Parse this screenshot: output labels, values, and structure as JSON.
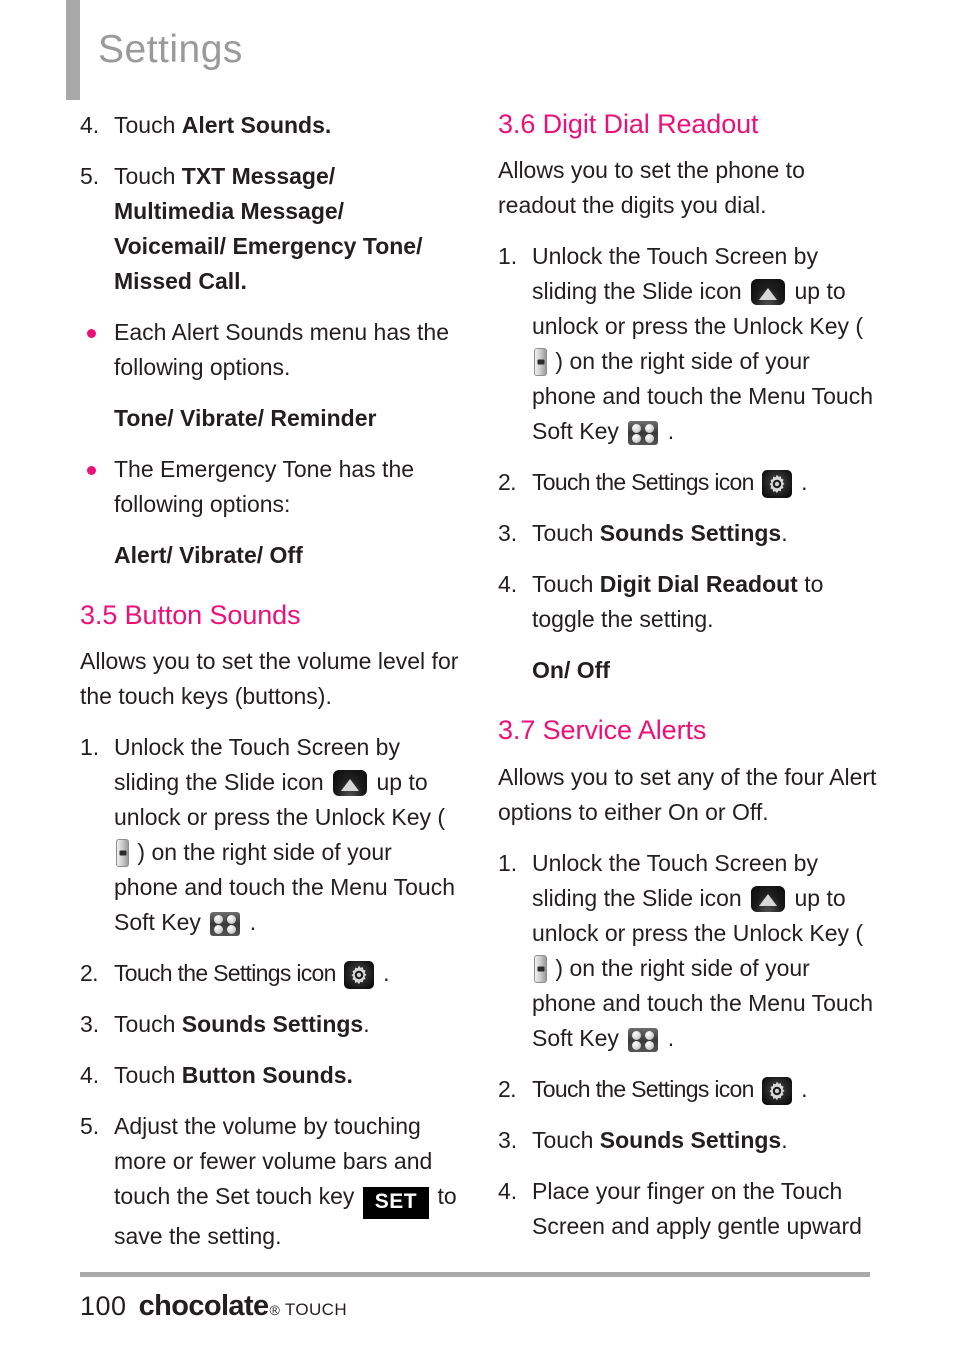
{
  "header": {
    "title": "Settings"
  },
  "left_column": {
    "blocks": [
      {
        "kind": "step",
        "num": "4.",
        "parts": [
          {
            "t": "Touch "
          },
          {
            "t": "Alert Sounds.",
            "bold": true
          }
        ]
      },
      {
        "kind": "step",
        "num": "5.",
        "parts": [
          {
            "t": "Touch "
          },
          {
            "t": "TXT Message/ Multimedia Message/ Voicemail/ Emergency Tone/ Missed Call.",
            "bold": true
          }
        ]
      },
      {
        "kind": "bullet",
        "parts": [
          {
            "t": "Each Alert Sounds menu has the following options."
          }
        ]
      },
      {
        "kind": "options",
        "text": "Tone/ Vibrate/ Reminder"
      },
      {
        "kind": "bullet",
        "parts": [
          {
            "t": "The Emergency Tone has the following options:"
          }
        ]
      },
      {
        "kind": "options",
        "text": "Alert/ Vibrate/ Off"
      },
      {
        "kind": "heading",
        "text": "3.5 Button Sounds"
      },
      {
        "kind": "para",
        "parts": [
          {
            "t": "Allows you to set the volume level for the touch keys (buttons)."
          }
        ]
      },
      {
        "kind": "step",
        "num": "1.",
        "parts": [
          {
            "t": "Unlock the Touch Screen by sliding the Slide icon "
          },
          {
            "icon": "slide-icon"
          },
          {
            "t": " up to unlock or press the Unlock Key ( "
          },
          {
            "icon": "unlock-key-icon"
          },
          {
            "t": " ) on the right side of your phone and touch the Menu Touch Soft Key "
          },
          {
            "icon": "menu-soft-key-icon"
          },
          {
            "t": " ."
          }
        ]
      },
      {
        "kind": "step",
        "num": "2.",
        "condensed": true,
        "parts": [
          {
            "t": "Touch the Settings icon "
          },
          {
            "icon": "settings-gear-icon"
          },
          {
            "t": " ."
          }
        ]
      },
      {
        "kind": "step",
        "num": "3.",
        "parts": [
          {
            "t": "Touch "
          },
          {
            "t": "Sounds Settings",
            "bold": true
          },
          {
            "t": "."
          }
        ]
      },
      {
        "kind": "step",
        "num": "4.",
        "parts": [
          {
            "t": "Touch "
          },
          {
            "t": "Button Sounds.",
            "bold": true
          }
        ]
      },
      {
        "kind": "step",
        "num": "5.",
        "parts": [
          {
            "t": "Adjust the volume by touching more or fewer volume bars and touch the Set touch key "
          },
          {
            "icon": "set-touch-key",
            "label": "SET"
          },
          {
            "t": " to save the setting."
          }
        ]
      }
    ]
  },
  "right_column": {
    "blocks": [
      {
        "kind": "heading",
        "first": true,
        "text": "3.6 Digit Dial Readout"
      },
      {
        "kind": "para",
        "parts": [
          {
            "t": "Allows you to set the phone to readout the digits you dial."
          }
        ]
      },
      {
        "kind": "step",
        "num": "1.",
        "parts": [
          {
            "t": "Unlock the Touch Screen by sliding the Slide icon "
          },
          {
            "icon": "slide-icon"
          },
          {
            "t": " up to unlock or press the Unlock Key ( "
          },
          {
            "icon": "unlock-key-icon"
          },
          {
            "t": " ) on the right side of your phone and touch the Menu Touch Soft Key "
          },
          {
            "icon": "menu-soft-key-icon"
          },
          {
            "t": " ."
          }
        ]
      },
      {
        "kind": "step",
        "num": "2.",
        "condensed": true,
        "parts": [
          {
            "t": "Touch the Settings icon "
          },
          {
            "icon": "settings-gear-icon"
          },
          {
            "t": " ."
          }
        ]
      },
      {
        "kind": "step",
        "num": "3.",
        "parts": [
          {
            "t": "Touch "
          },
          {
            "t": "Sounds Settings",
            "bold": true
          },
          {
            "t": "."
          }
        ]
      },
      {
        "kind": "step",
        "num": "4.",
        "parts": [
          {
            "t": "Touch "
          },
          {
            "t": "Digit Dial Readout",
            "bold": true
          },
          {
            "t": " to toggle the setting."
          }
        ]
      },
      {
        "kind": "options",
        "text": "On/ Off"
      },
      {
        "kind": "heading",
        "text": "3.7 Service Alerts"
      },
      {
        "kind": "para",
        "parts": [
          {
            "t": "Allows you to set any of the four Alert options to either On or Off."
          }
        ]
      },
      {
        "kind": "step",
        "num": "1.",
        "parts": [
          {
            "t": "Unlock the Touch Screen by sliding the Slide icon "
          },
          {
            "icon": "slide-icon"
          },
          {
            "t": " up to unlock or press the Unlock Key ( "
          },
          {
            "icon": "unlock-key-icon"
          },
          {
            "t": " ) on the right side of your phone and touch the Menu Touch Soft Key "
          },
          {
            "icon": "menu-soft-key-icon"
          },
          {
            "t": " ."
          }
        ]
      },
      {
        "kind": "step",
        "num": "2.",
        "condensed": true,
        "parts": [
          {
            "t": "Touch the Settings icon "
          },
          {
            "icon": "settings-gear-icon"
          },
          {
            "t": " ."
          }
        ]
      },
      {
        "kind": "step",
        "num": "3.",
        "parts": [
          {
            "t": "Touch "
          },
          {
            "t": "Sounds Settings",
            "bold": true
          },
          {
            "t": "."
          }
        ]
      },
      {
        "kind": "step",
        "num": "4.",
        "parts": [
          {
            "t": "Place your finger on the Touch Screen and apply gentle upward"
          }
        ]
      }
    ]
  },
  "footer": {
    "page_number": "100",
    "brand": "chocolate",
    "registered_mark": "®",
    "sub_brand": "TOUCH"
  },
  "colors": {
    "accent_magenta": "#ec1178",
    "header_gray": "#9a9a9a",
    "rule_gray": "#a9a9a9",
    "body_text": "#231f20"
  }
}
